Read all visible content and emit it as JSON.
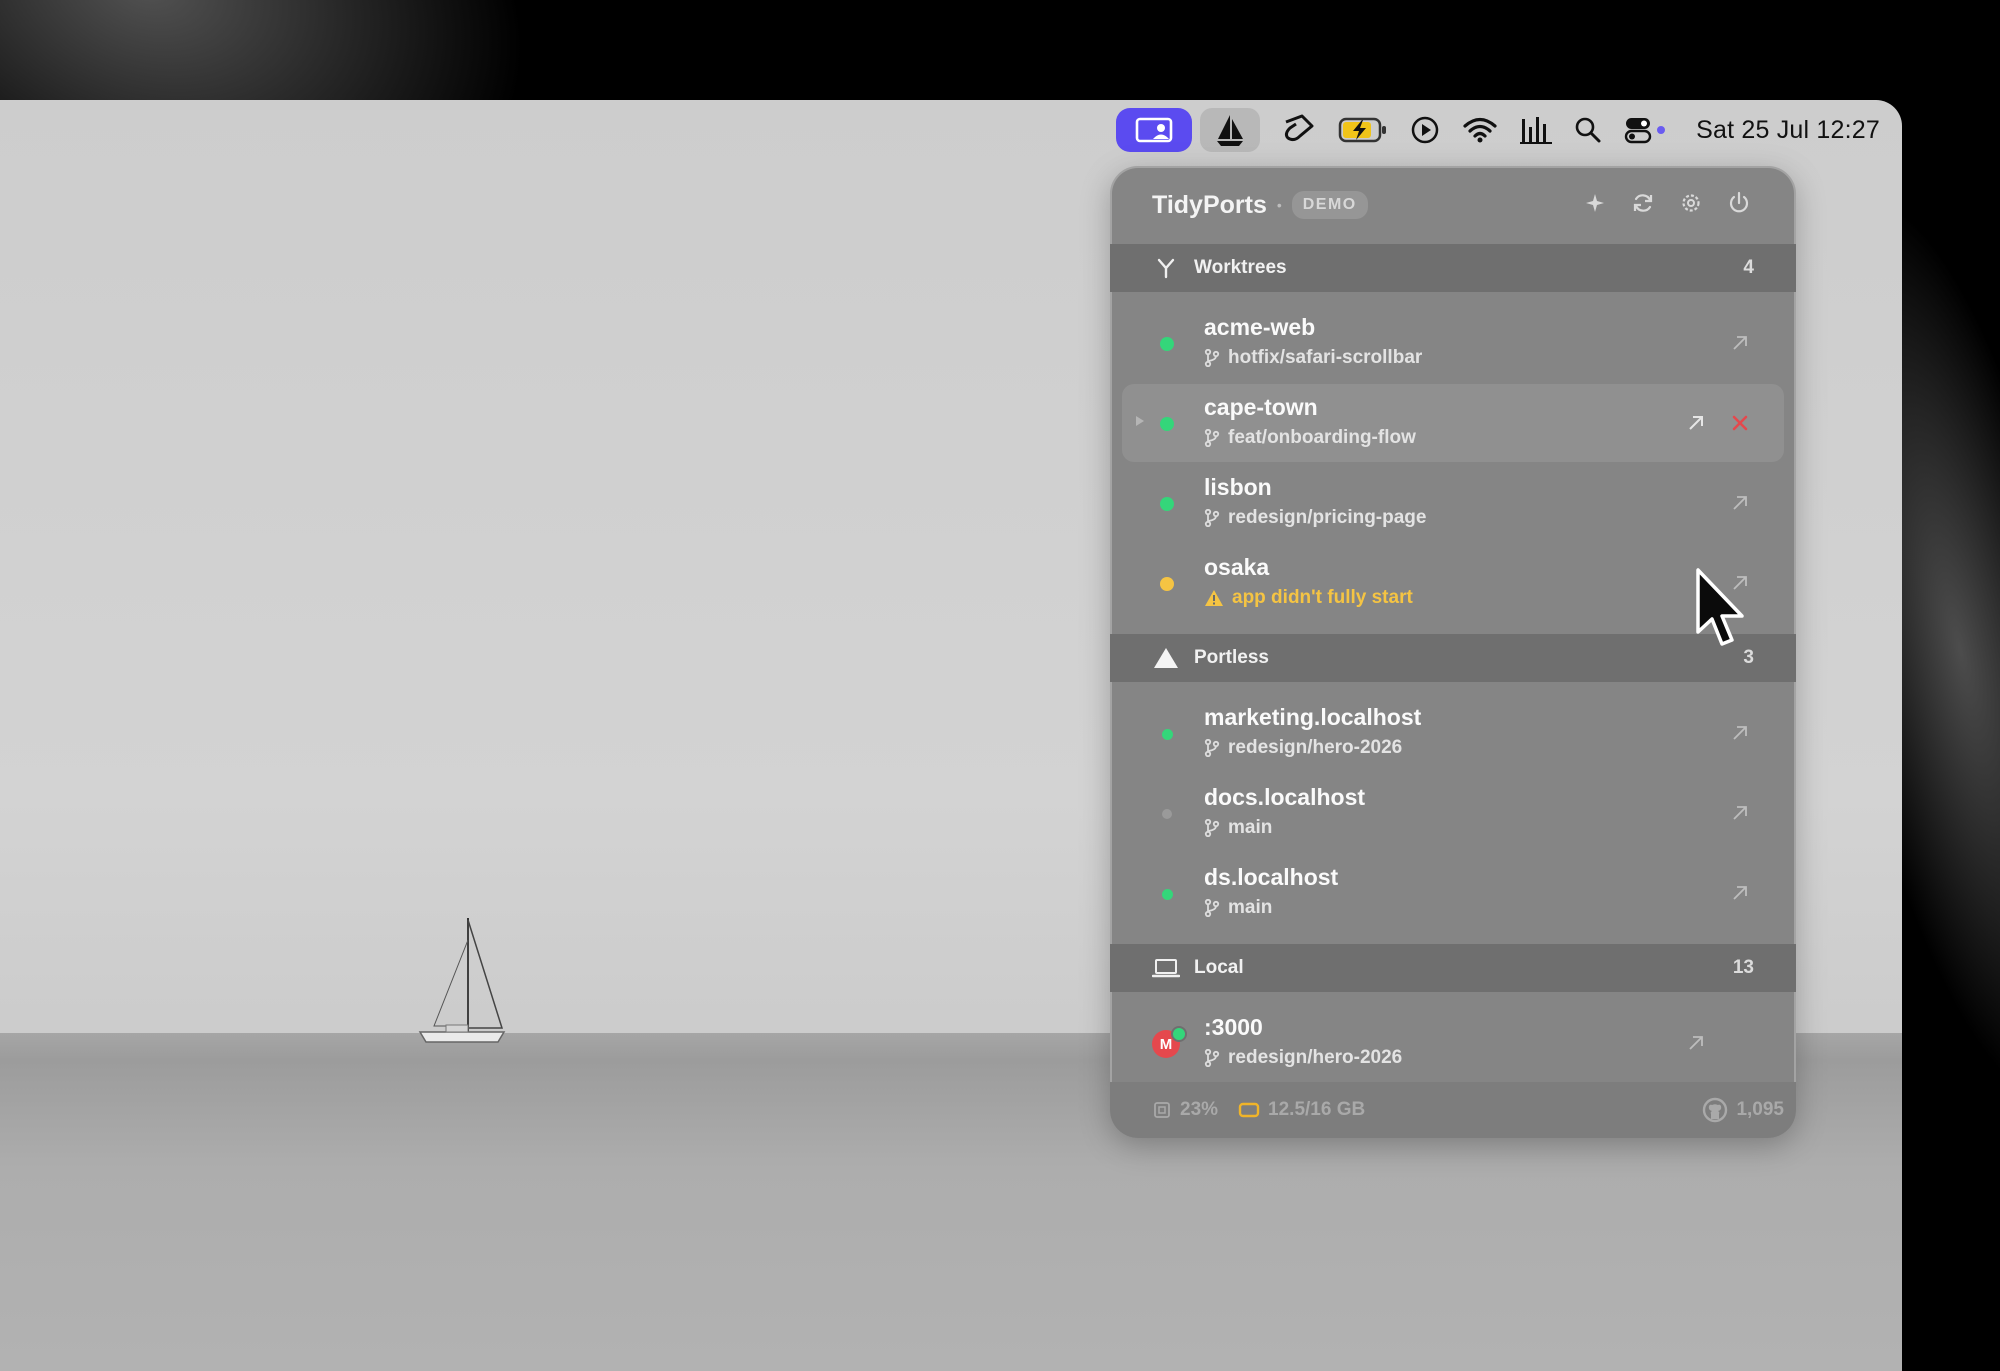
{
  "menubar": {
    "active_app_icon": "tidyports-icon",
    "icons": [
      "sailboat-icon",
      "hook-icon",
      "battery-charging-icon",
      "play-circle-icon",
      "wifi-icon",
      "audio-levels-icon",
      "search-icon",
      "control-center-icon"
    ],
    "clock": "Sat 25 Jul  12:27"
  },
  "panel": {
    "title": "TidyPorts",
    "badge": "DEMO",
    "header_icons": [
      "sparkle-icon",
      "refresh-icon",
      "gear-icon",
      "power-icon"
    ],
    "sections": {
      "worktrees": {
        "label": "Worktrees",
        "count": "4",
        "icon": "branch-fork-icon",
        "items": [
          {
            "name": "acme-web",
            "sub": "hotfix/safari-scrollbar",
            "status_color": "#34d67a"
          },
          {
            "name": "cape-town",
            "sub": "feat/onboarding-flow",
            "status_color": "#34d67a"
          },
          {
            "name": "lisbon",
            "sub": "redesign/pricing-page",
            "status_color": "#34d67a"
          },
          {
            "name": "osaka",
            "sub": "app didn't fully start",
            "status_color": "#f5c443"
          }
        ]
      },
      "portless": {
        "label": "Portless",
        "count": "3",
        "icon": "triangle-icon",
        "items": [
          {
            "name": "marketing.localhost",
            "sub": "redesign/hero-2026",
            "status_color": "#34d67a"
          },
          {
            "name": "docs.localhost",
            "sub": "main",
            "status_color": "#9a9a9a"
          },
          {
            "name": "ds.localhost",
            "sub": "main",
            "status_color": "#34d67a"
          }
        ]
      },
      "local": {
        "label": "Local",
        "count": "13",
        "icon": "laptop-icon",
        "items": [
          {
            "name": ":3000",
            "sub": "redesign/hero-2026",
            "avatar_letter": "M",
            "status_color": "#34d67a"
          }
        ]
      }
    },
    "footer": {
      "cpu": "23%",
      "memory": "12.5/16 GB",
      "github_count": "1,095"
    }
  },
  "colors": {
    "accent": "#5b4bf0",
    "running": "#34d67a",
    "warning": "#f5c443",
    "danger": "#e5484d"
  }
}
